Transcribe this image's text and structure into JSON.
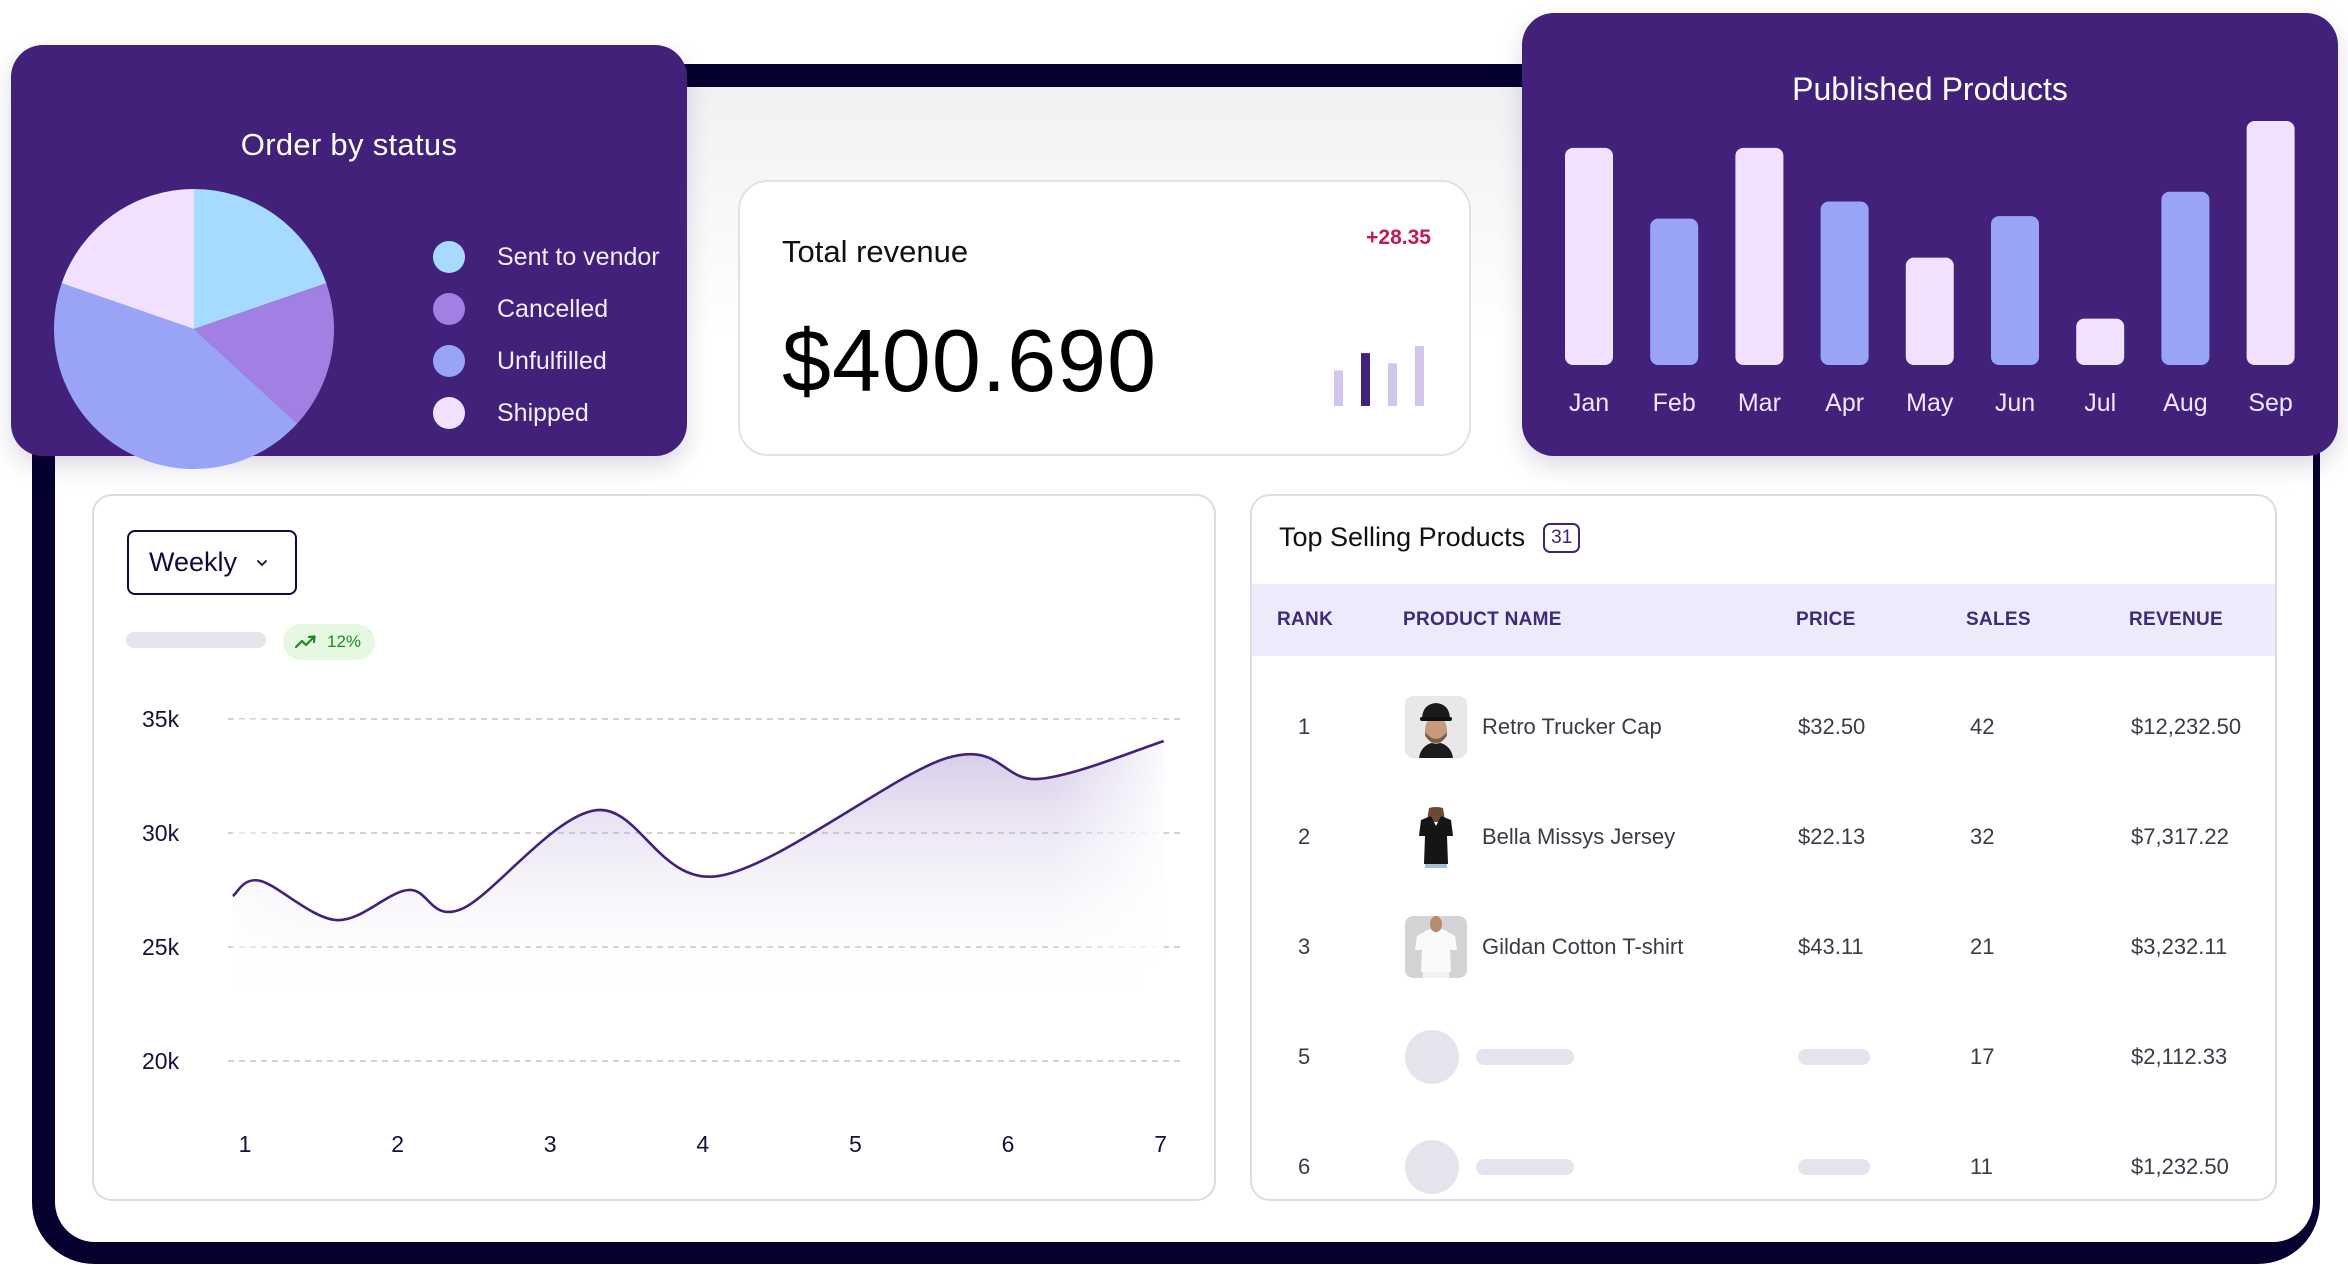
{
  "colors": {
    "frame": "#05002f",
    "card_purple": "#42217a",
    "accent_line": "#42217a",
    "delta_red": "#c0195a",
    "trend_green": "#1b8a22",
    "table_header_bg": "#eceafb"
  },
  "order_status": {
    "title": "Order by status",
    "chart_data": {
      "type": "pie",
      "title": "Order by status",
      "legend_position": "right",
      "slices": [
        {
          "label": "Sent to vendor",
          "value": 19.7,
          "color": "#a6dbff"
        },
        {
          "label": "Cancelled",
          "value": 17.1,
          "color": "#a27fe3"
        },
        {
          "label": "Unfulfilled",
          "value": 43.5,
          "color": "#9aa4f6"
        },
        {
          "label": "Shipped",
          "value": 19.7,
          "color": "#f1e1ff"
        }
      ]
    }
  },
  "revenue": {
    "label": "Total revenue",
    "value": "$400.690",
    "delta": "+28.35",
    "sparkbars": [
      {
        "value": 35,
        "highlight": false
      },
      {
        "value": 52,
        "highlight": true
      },
      {
        "value": 42,
        "highlight": false
      },
      {
        "value": 59,
        "highlight": false
      }
    ]
  },
  "published_products": {
    "title": "Published Products",
    "chart_data": {
      "type": "bar",
      "title": "Published Products",
      "categories": [
        "Jan",
        "Feb",
        "Mar",
        "Apr",
        "May",
        "Jun",
        "Jul",
        "Aug",
        "Sep"
      ],
      "values": [
        89,
        60,
        89,
        67,
        44,
        61,
        19,
        71,
        100
      ],
      "colors": [
        "#f1e1ff",
        "#9aa4f6",
        "#f1e1ff",
        "#9aa4f6",
        "#f1e1ff",
        "#9aa4f6",
        "#f1e1ff",
        "#9aa4f6",
        "#f1e1ff"
      ],
      "xlabel": "",
      "ylabel": "",
      "ylim": [
        0,
        100
      ],
      "grid": false
    }
  },
  "sales_chart": {
    "period": "Weekly",
    "trend": "12%",
    "chart_data": {
      "type": "area",
      "x": [
        0.92,
        1.1,
        1.6,
        2.07,
        2.42,
        3.3,
        4.1,
        5.6,
        6.2,
        7.02
      ],
      "y": [
        27240,
        27900,
        26180,
        27500,
        26670,
        31000,
        28110,
        33290,
        32370,
        34030
      ],
      "xticks": [
        "1",
        "2",
        "3",
        "4",
        "5",
        "6",
        "7"
      ],
      "yticks": [
        "35k",
        "30k",
        "25k",
        "20k"
      ],
      "ytick_values": [
        35000,
        30000,
        25000,
        20000
      ],
      "ylim": [
        20000,
        35000
      ],
      "xlim": [
        1,
        7
      ],
      "grid": true,
      "xlabel": "",
      "ylabel": ""
    }
  },
  "top_selling": {
    "title": "Top Selling Products",
    "count": "31",
    "columns": [
      "RANK",
      "PRODUCT NAME",
      "PRICE",
      "SALES",
      "REVENUE"
    ],
    "rows": [
      {
        "rank": "1",
        "name": "Retro Trucker Cap",
        "price": "$32.50",
        "sales": "42",
        "revenue": "$12,232.50",
        "thumb": "cap"
      },
      {
        "rank": "2",
        "name": "Bella Missys Jersey",
        "price": "$22.13",
        "sales": "32",
        "revenue": "$7,317.22",
        "thumb": "jersey"
      },
      {
        "rank": "3",
        "name": "Gildan Cotton T-shirt",
        "price": "$43.11",
        "sales": "21",
        "revenue": "$3,232.11",
        "thumb": "tshirt"
      },
      {
        "rank": "5",
        "name": null,
        "price": null,
        "sales": "17",
        "revenue": "$2,112.33",
        "thumb": null
      },
      {
        "rank": "6",
        "name": null,
        "price": null,
        "sales": "11",
        "revenue": "$1,232.50",
        "thumb": null
      }
    ]
  }
}
